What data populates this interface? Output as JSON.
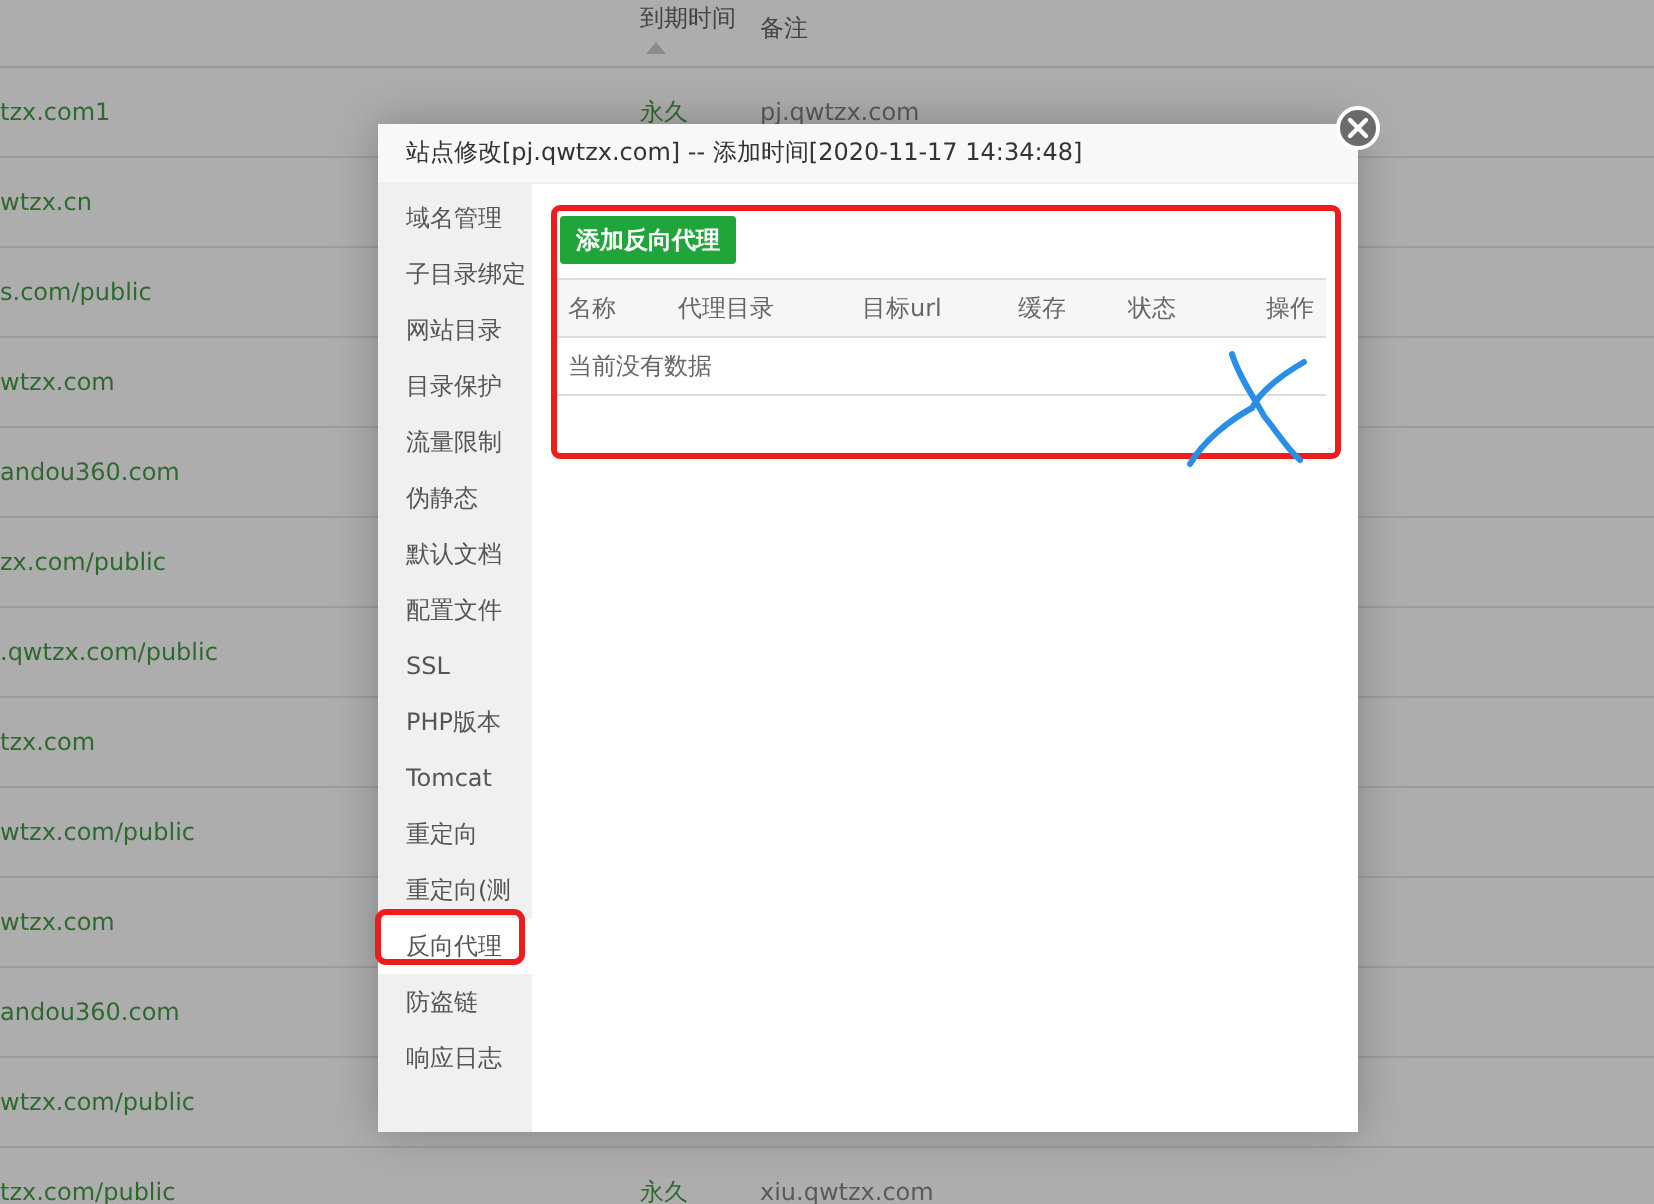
{
  "background_table": {
    "columns": [
      {
        "label": "到期时间",
        "sorted": true
      },
      {
        "label": "备注",
        "sorted": false
      }
    ],
    "rows": [
      {
        "name": "tzx.com1",
        "expiry": "永久",
        "note": "pj.qwtzx.com"
      },
      {
        "name": "wtzx.cn"
      },
      {
        "name": "s.com/public"
      },
      {
        "name": "wtzx.com"
      },
      {
        "name": "andou360.com"
      },
      {
        "name": "zx.com/public"
      },
      {
        "name": ".qwtzx.com/public"
      },
      {
        "name": "tzx.com"
      },
      {
        "name": "wtzx.com/public"
      },
      {
        "name": "wtzx.com"
      },
      {
        "name": "andou360.com"
      },
      {
        "name": "wtzx.com/public"
      },
      {
        "name": "tzx.com/public",
        "expiry": "永久",
        "note": "xiu.qwtzx.com"
      }
    ]
  },
  "dialog": {
    "title": "站点修改[pj.qwtzx.com] -- 添加时间[2020-11-17 14:34:48]",
    "sidebar": [
      {
        "label": "域名管理",
        "selected": false
      },
      {
        "label": "子目录绑定",
        "selected": false
      },
      {
        "label": "网站目录",
        "selected": false
      },
      {
        "label": "目录保护",
        "selected": false
      },
      {
        "label": "流量限制",
        "selected": false
      },
      {
        "label": "伪静态",
        "selected": false
      },
      {
        "label": "默认文档",
        "selected": false
      },
      {
        "label": "配置文件",
        "selected": false
      },
      {
        "label": "SSL",
        "selected": false
      },
      {
        "label": "PHP版本",
        "selected": false
      },
      {
        "label": "Tomcat",
        "selected": false
      },
      {
        "label": "重定向",
        "selected": false
      },
      {
        "label": "重定向(测",
        "selected": false
      },
      {
        "label": "反向代理",
        "selected": true
      },
      {
        "label": "防盗链",
        "selected": false
      },
      {
        "label": "响应日志",
        "selected": false
      }
    ],
    "add_button": "添加反向代理",
    "table": {
      "columns": [
        "名称",
        "代理目录",
        "目标url",
        "缓存",
        "状态",
        "操作"
      ],
      "empty_text": "当前没有数据"
    }
  }
}
